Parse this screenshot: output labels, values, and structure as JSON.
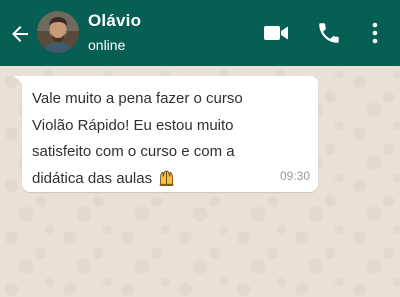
{
  "header": {
    "contact_name": "Olávio",
    "status": "online"
  },
  "message": {
    "text": "Vale muito a pena fazer o curso Violão Rápido! Eu estou muito satisfeito com o curso e com a didática das aulas",
    "emoji": "raising-hands",
    "time": "09:30"
  },
  "colors": {
    "header_bg": "#075e54",
    "chat_bg": "#e9e1d8",
    "bubble_bg": "#ffffff"
  }
}
